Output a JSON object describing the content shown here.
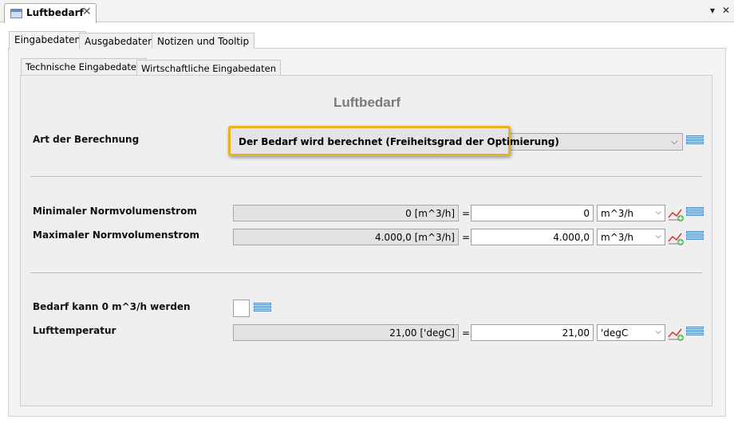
{
  "document_tab": {
    "title": "Luftbedarf",
    "close": "✕"
  },
  "window_controls": {
    "menu": "▾",
    "close": "✕"
  },
  "outer_tabs": [
    "Eingabedaten",
    "Ausgabedaten",
    "Notizen und Tooltip"
  ],
  "inner_tabs": [
    "Technische Eingabedaten",
    "Wirtschaftliche Eingabedaten"
  ],
  "heading": "Luftbedarf",
  "calc_mode": {
    "label": "Art der Berechnung",
    "value": "Der Bedarf wird berechnet (Freiheitsgrad der Optimierung)"
  },
  "rows": [
    {
      "label": "Minimaler Normvolumenstrom",
      "readonly": "0 [m^3/h]",
      "eq": "=",
      "value": "0",
      "unit": "m^3/h"
    },
    {
      "label": "Maximaler Normvolumenstrom",
      "readonly": "4.000,0 [m^3/h]",
      "eq": "=",
      "value": "4.000,0",
      "unit": "m^3/h"
    },
    {
      "label": "Lufttemperatur",
      "readonly": "21,00 ['degC]",
      "eq": "=",
      "value": "21,00",
      "unit": "'degC"
    }
  ],
  "zero_flag": {
    "label": "Bedarf kann 0 m^3/h werden",
    "checked": false
  },
  "icons": {
    "list": "list-icon",
    "chart": "chart-add-icon",
    "dropdown": "chevron-down-icon"
  },
  "colors": {
    "highlight": "#e8b21c",
    "accent_blue": "#4f86c6"
  }
}
